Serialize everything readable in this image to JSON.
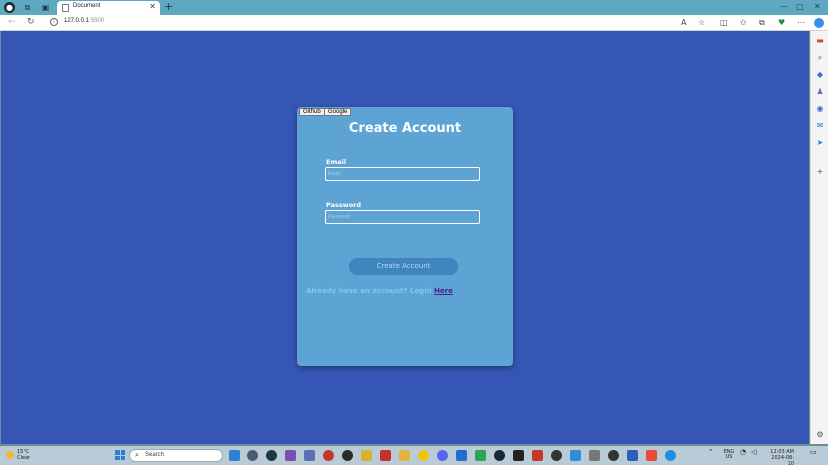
{
  "browser": {
    "tab_title": "Document",
    "url_host": "127.0.0.1",
    "url_port": ":5500"
  },
  "page": {
    "oauth_buttons": [
      "Github",
      "Google"
    ],
    "title": "Create Account",
    "email_label": "Email",
    "email_placeholder": "Email",
    "password_label": "Password",
    "password_placeholder": "Password",
    "submit_label": "Create Account",
    "login_prompt": "Already have an account? Login ",
    "login_link": "Here"
  },
  "taskbar": {
    "weather_temp": "15°C",
    "weather_desc": "Clear",
    "search_placeholder": "Search",
    "lang_top": "ENG",
    "lang_bottom": "US",
    "time": "12:03 AM",
    "date": "2024-08-10"
  },
  "colors": {
    "page_bg": "#3556b4",
    "card_bg": "#5da3d4",
    "button_bg": "#3f86bf",
    "link": "#4b1f8c"
  }
}
